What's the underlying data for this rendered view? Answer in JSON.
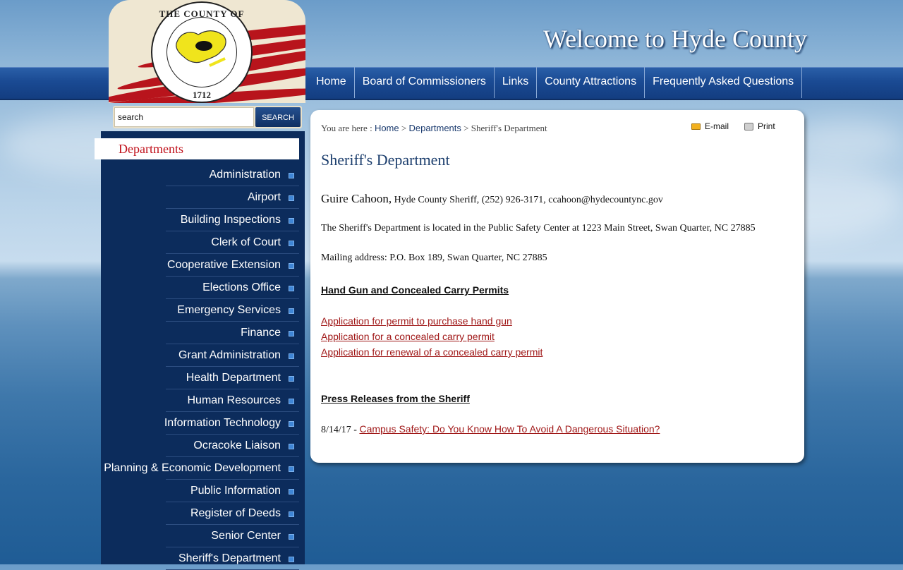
{
  "header": {
    "welcome": "Welcome to Hyde County",
    "seal_top_text": "THE COUNTY OF HYDE",
    "seal_year": "1712",
    "nav": [
      "Home",
      "Board of Commissioners",
      "Links",
      "County Attractions",
      "Frequently Asked Questions"
    ]
  },
  "search": {
    "value": "search",
    "button": "SEARCH"
  },
  "sidebar": {
    "heading": "Departments",
    "items": [
      "Administration",
      "Airport",
      "Building Inspections",
      "Clerk of Court",
      "Cooperative Extension",
      "Elections Office",
      "Emergency Services",
      "Finance",
      "Grant Administration",
      "Health Department",
      "Human Resources",
      "Information Technology",
      "Ocracoke Liaison",
      "Planning & Economic Development",
      "Public Information",
      "Register of Deeds",
      "Senior Center",
      "Sheriff's Department"
    ]
  },
  "breadcrumb": {
    "prefix": "You are here : ",
    "home": "Home",
    "sep1": " > ",
    "departments": "Departments",
    "sep2": " > ",
    "current": "Sheriff's Department"
  },
  "tools": {
    "email": "E-mail",
    "print": "Print"
  },
  "content": {
    "title": "Sheriff's Department",
    "sheriff_name": "Guire Cahoon,",
    "sheriff_info": " Hyde County Sheriff, (252) 926-3171, ccahoon@hydecountync.gov",
    "location": "The Sheriff's Department is located in the Public Safety Center at 1223 Main Street, Swan Quarter, NC 27885",
    "mailing": "Mailing address: P.O. Box 189, Swan Quarter, NC 27885",
    "permits_heading": "Hand Gun and Concealed Carry Permits",
    "permit_links": [
      "Application for permit to purchase hand gun",
      "Application for a concealed carry permit",
      "Application for renewal of a concealed carry permit"
    ],
    "press_heading": "Press Releases from the Sheriff",
    "press_date": "8/14/17 - ",
    "press_link": "Campus Safety: Do You Know How To Avoid A Dangerous Situation?"
  },
  "colors": {
    "nav_blue": "#1a4a93",
    "sidebar_navy": "#0c2c5c",
    "link_red": "#a01818",
    "title_blue": "#1d3f6e"
  }
}
